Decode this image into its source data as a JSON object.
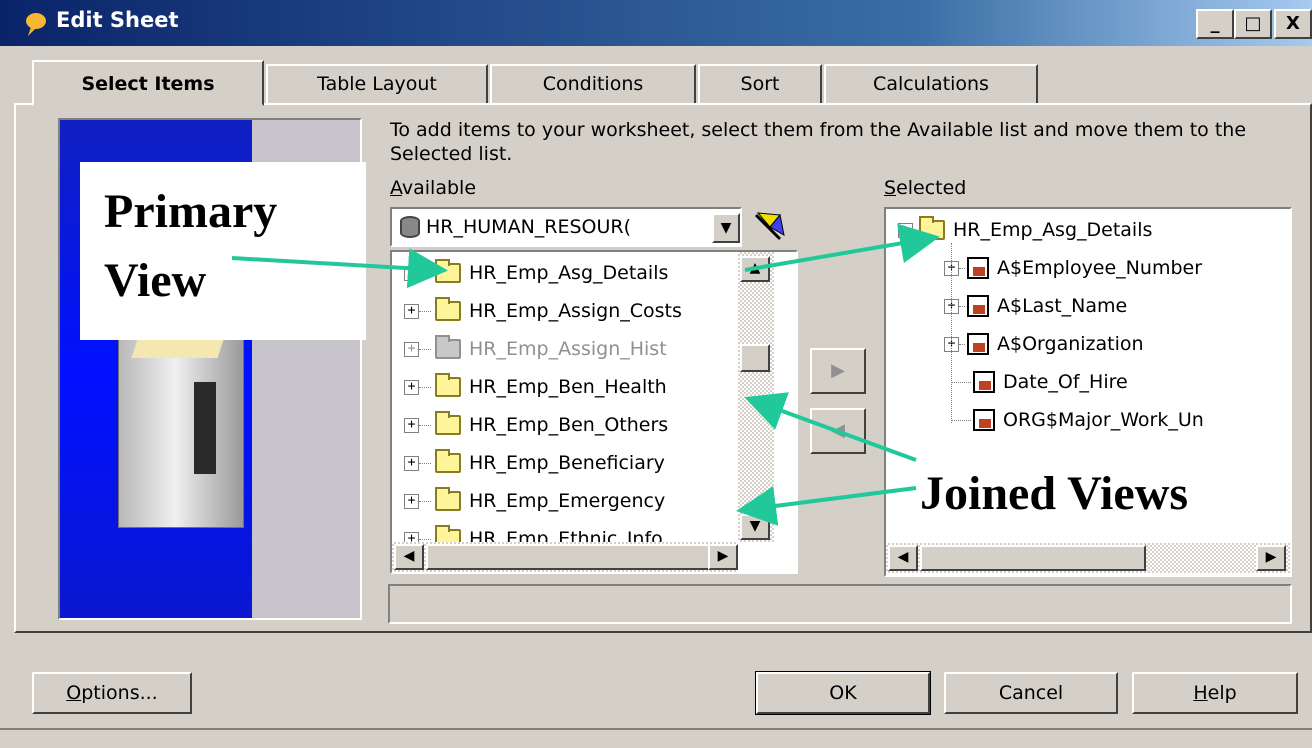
{
  "window": {
    "title": "Edit Sheet",
    "minimize": "_",
    "maximize": "□",
    "close": "X"
  },
  "tabs": [
    {
      "label": "Select Items",
      "active": true
    },
    {
      "label": "Table Layout"
    },
    {
      "label": "Conditions"
    },
    {
      "label": "Sort"
    },
    {
      "label": "Calculations"
    }
  ],
  "instructions": "To add items to your worksheet, select them from the Available list and move them to the Selected list.",
  "available": {
    "label_prefix": "A",
    "label_rest": "vailable",
    "dropdown_value": "HR_HUMAN_RESOUR(",
    "items": [
      {
        "label": "HR_Emp_Asg_Details",
        "disabled": false
      },
      {
        "label": "HR_Emp_Assign_Costs",
        "disabled": false
      },
      {
        "label": "HR_Emp_Assign_Hist",
        "disabled": true
      },
      {
        "label": "HR_Emp_Ben_Health",
        "disabled": false
      },
      {
        "label": "HR_Emp_Ben_Others",
        "disabled": false
      },
      {
        "label": "HR_Emp_Beneficiary",
        "disabled": false
      },
      {
        "label": "HR_Emp_Emergency",
        "disabled": false
      },
      {
        "label": "HR_Emp_Ethnic_Info",
        "disabled": false
      }
    ]
  },
  "selected": {
    "label_prefix": "S",
    "label_rest": "elected",
    "root": "HR_Emp_Asg_Details",
    "items": [
      {
        "label": "A$Employee_Number",
        "expandable": true
      },
      {
        "label": "A$Last_Name",
        "expandable": true
      },
      {
        "label": "A$Organization",
        "expandable": true
      },
      {
        "label": "Date_Of_Hire",
        "expandable": false
      },
      {
        "label": "ORG$Major_Work_Un",
        "expandable": false
      }
    ]
  },
  "annotations": {
    "primary_line1": "Primary",
    "primary_line2": "View",
    "joined": "Joined Views"
  },
  "buttons": {
    "options_prefix": "O",
    "options_rest": "ptions...",
    "ok": "OK",
    "cancel": "Cancel",
    "help_prefix": "H",
    "help_rest": "elp"
  },
  "colors": {
    "annotation_arrow": "#20c89a",
    "title_bar": "#0a246a"
  }
}
